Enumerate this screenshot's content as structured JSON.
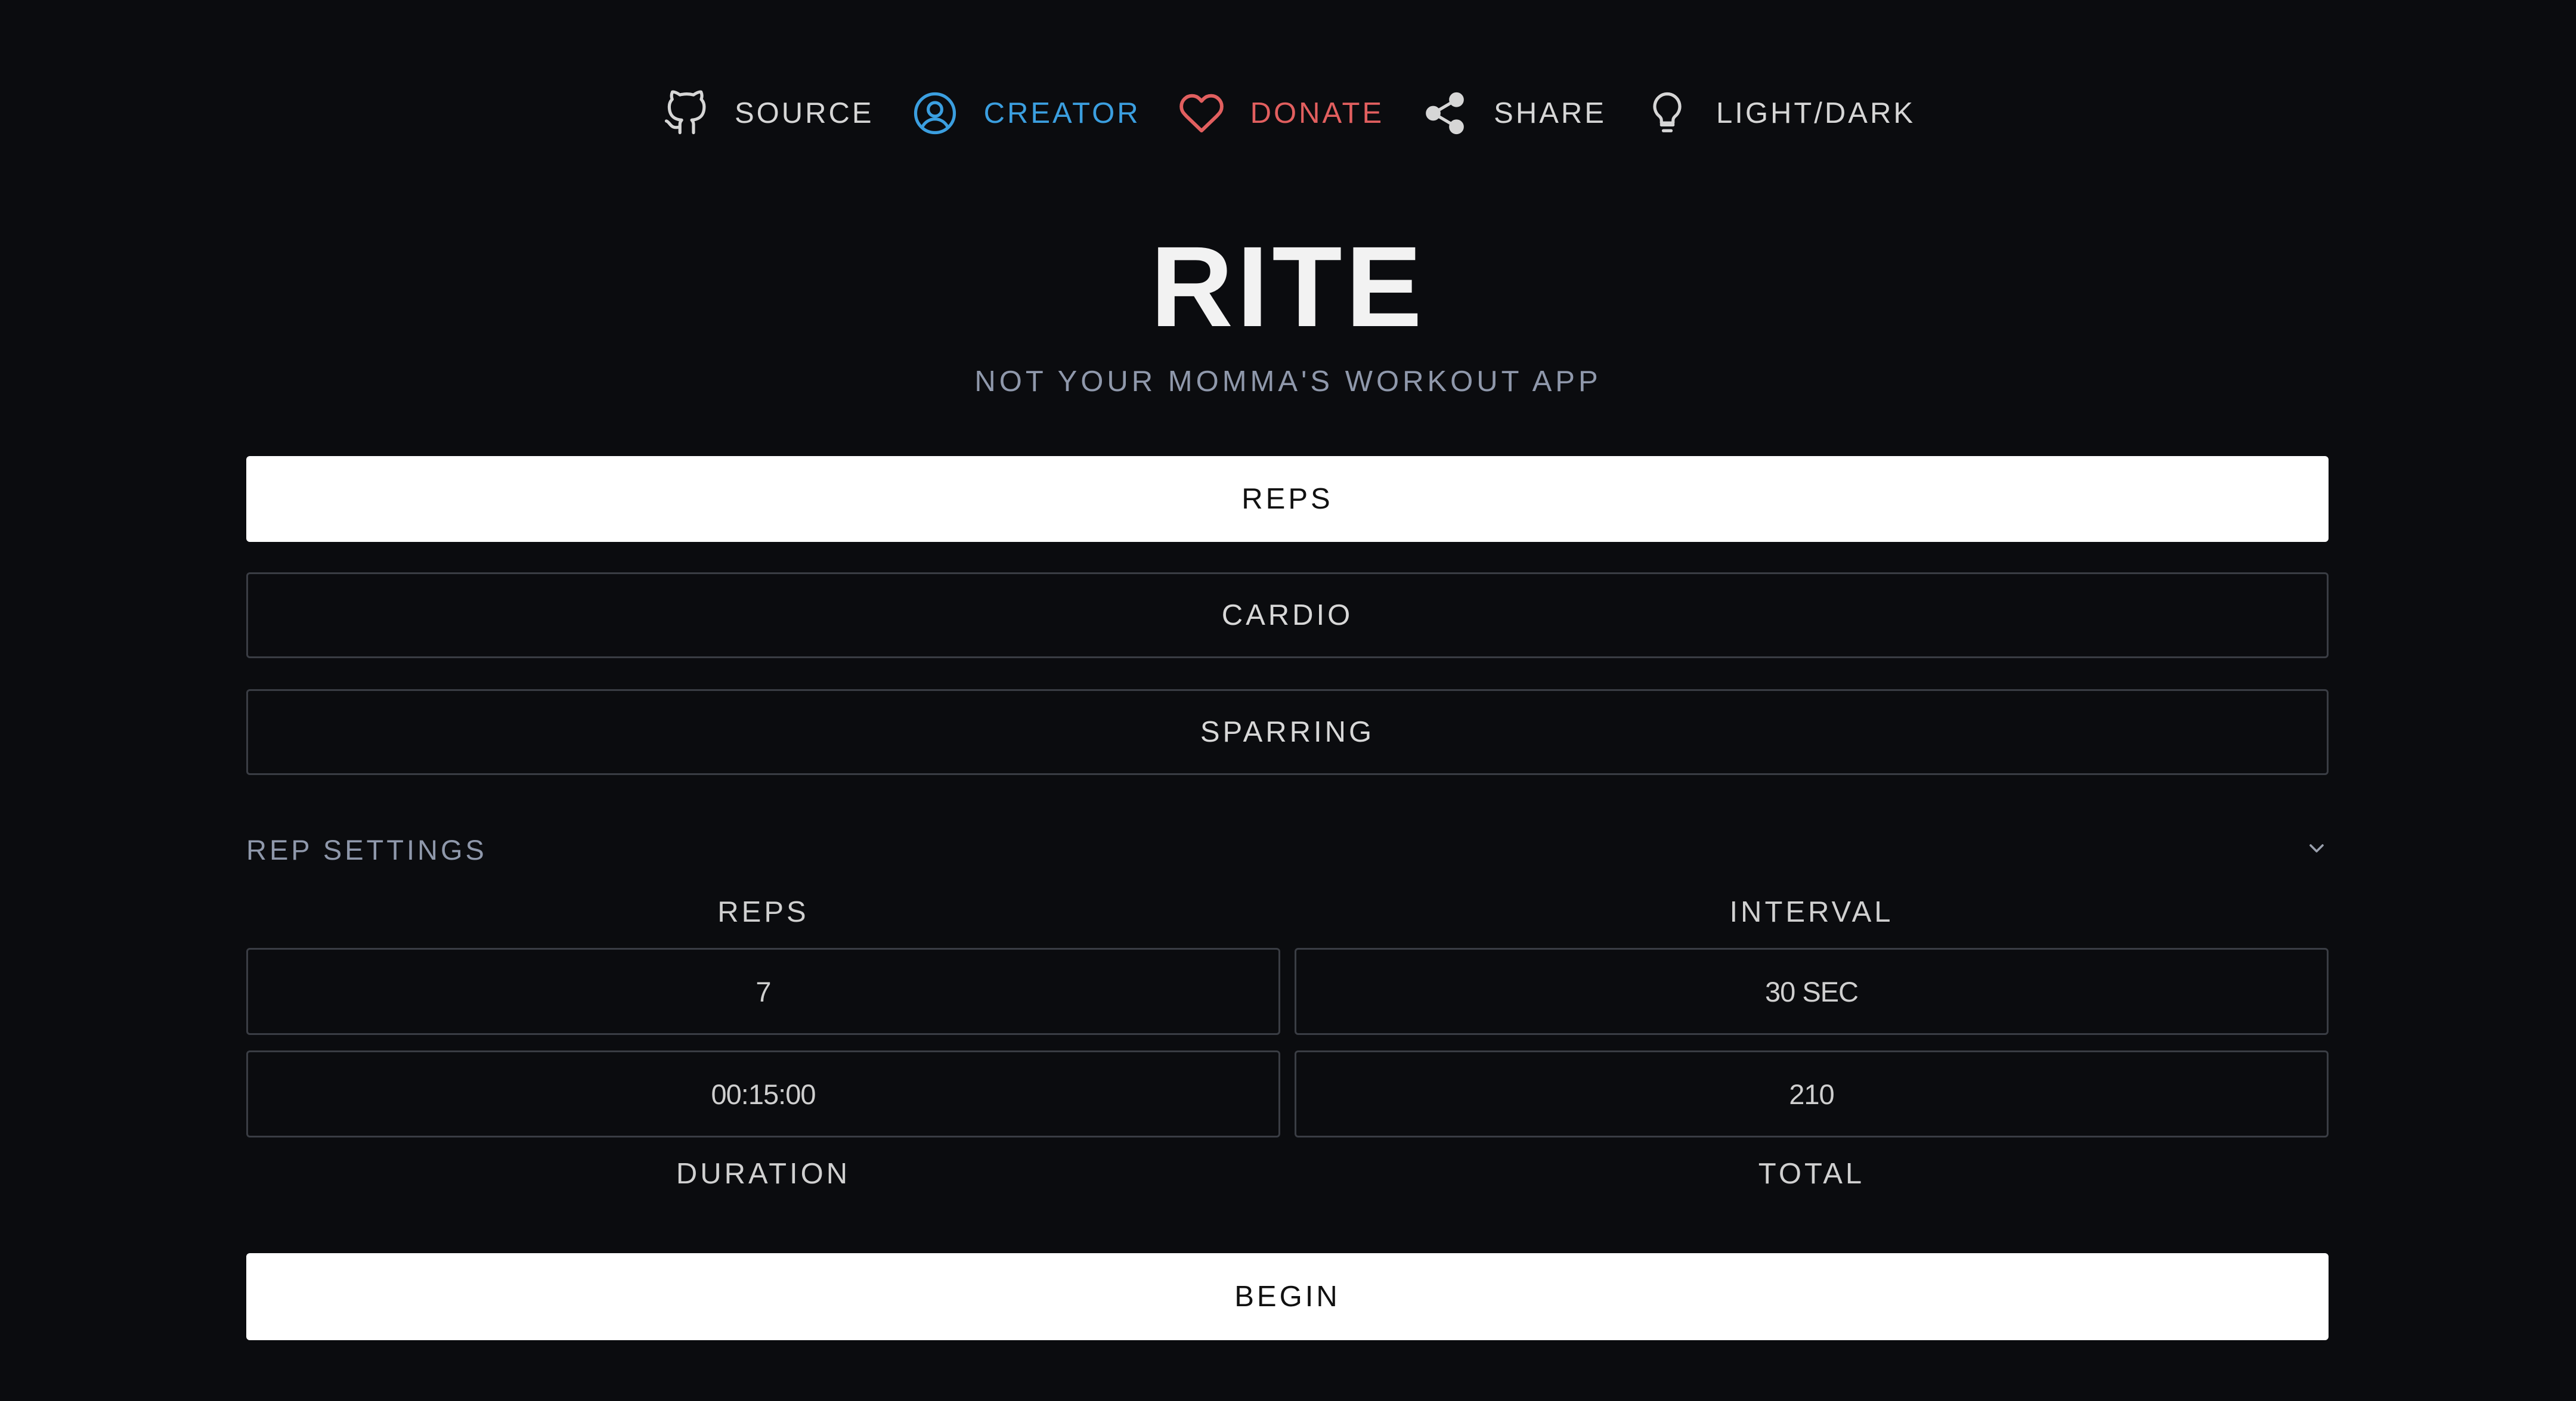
{
  "nav": {
    "items": [
      {
        "label": "SOURCE",
        "icon": "github-icon",
        "color": "#d6d6d6"
      },
      {
        "label": "CREATOR",
        "icon": "user-circle-icon",
        "color": "#3b9fe0"
      },
      {
        "label": "DONATE",
        "icon": "heart-icon",
        "color": "#e25f5f"
      },
      {
        "label": "SHARE",
        "icon": "share-icon",
        "color": "#d6d6d6"
      },
      {
        "label": "LIGHT/DARK",
        "icon": "lightbulb-icon",
        "color": "#d6d6d6"
      }
    ]
  },
  "header": {
    "title": "RITE",
    "subtitle": "NOT YOUR MOMMA'S WORKOUT APP"
  },
  "modes": {
    "items": [
      {
        "label": "REPS",
        "selected": true
      },
      {
        "label": "CARDIO",
        "selected": false
      },
      {
        "label": "SPARRING",
        "selected": false
      }
    ]
  },
  "settings": {
    "title": "REP SETTINGS",
    "reps_label": "REPS",
    "reps_value": "7",
    "interval_label": "INTERVAL",
    "interval_value": "30 SEC",
    "duration_label": "DURATION",
    "duration_value": "00:15:00",
    "total_label": "TOTAL",
    "total_value": "210"
  },
  "actions": {
    "begin_label": "BEGIN"
  },
  "colors": {
    "background": "#0b0c0f",
    "accent_blue": "#3b9fe0",
    "accent_red": "#e25f5f",
    "muted": "#8f98ab"
  }
}
